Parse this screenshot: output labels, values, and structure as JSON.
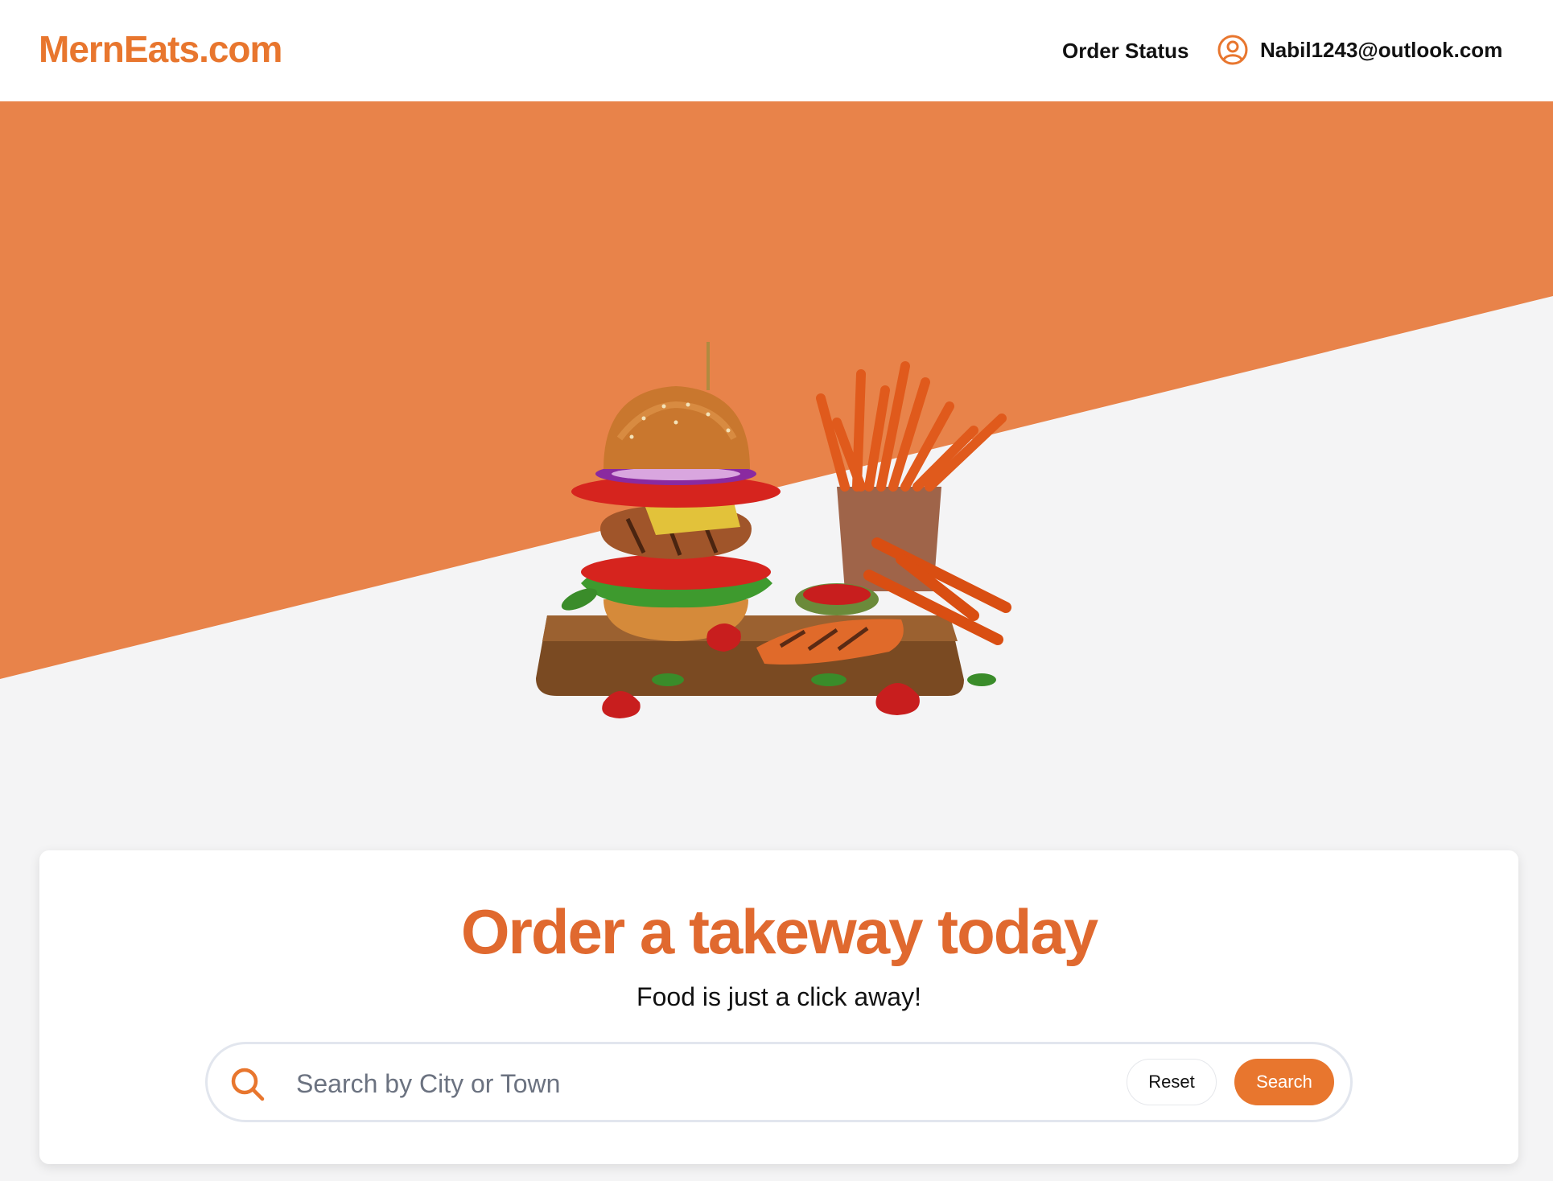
{
  "header": {
    "logo": "MernEats.com",
    "nav": {
      "order_status": "Order Status"
    },
    "user": {
      "email": "Nabil1243@outlook.com",
      "icon": "user-circle-icon"
    }
  },
  "hero": {
    "image": "burger-and-fries-illustration",
    "colors": {
      "accent": "#e8834a",
      "background": "#f4f4f5"
    }
  },
  "search_card": {
    "title": "Order a takeway today",
    "subtitle": "Food is just a click away!",
    "search": {
      "placeholder": "Search by City or Town",
      "value": "",
      "icon": "search-icon"
    },
    "reset_label": "Reset",
    "search_label": "Search"
  },
  "colors": {
    "brand": "#e8762e",
    "headline": "#e0692f",
    "text": "#111111"
  }
}
